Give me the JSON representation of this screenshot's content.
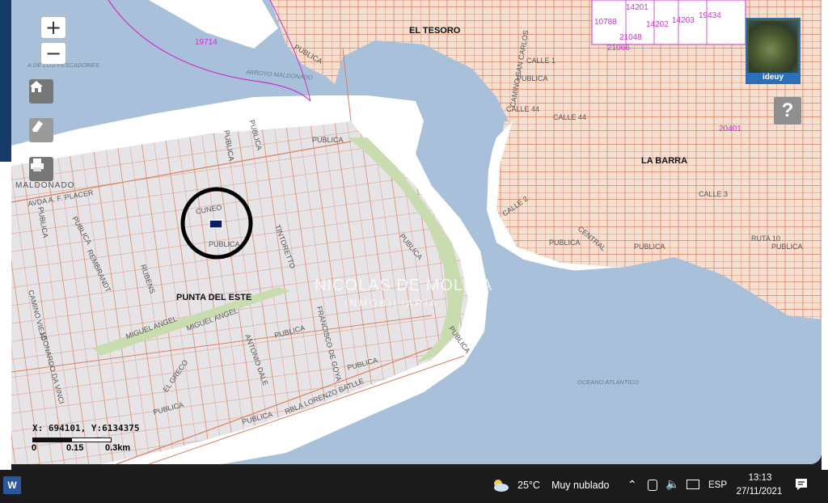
{
  "map": {
    "places": {
      "el_tesoro": "EL TESORO",
      "la_barra": "LA BARRA",
      "punta_del_este": "PUNTA DEL ESTE",
      "maldonado": "MALDONADO"
    },
    "water_labels": {
      "arroyo": "ARROYO MALDONADO",
      "oceano": "OCEANO ATLANTICO",
      "pescadores": "A DE LOS PESCADORES"
    },
    "parcels": [
      "19714",
      "14201",
      "10788",
      "14202",
      "14203",
      "19434",
      "21048",
      "21066",
      "20401"
    ],
    "streets": {
      "publica": "PUBLICA",
      "calle1": "CALLE 1",
      "calle44": "CALLE 44",
      "calle44b": "CALLE 44",
      "calle2": "CALLE 2",
      "calle3": "CALLE 3",
      "cuneo": "CUNEO",
      "avpaz": "AVDA A. F. PLACER",
      "rubens": "RUBENS",
      "miguel1": "MIGUEL ANGEL",
      "miguel2": "MIGUEL ANGEL",
      "antonio": "ANTONIO DALE",
      "francisco": "FRANCISCO DE GOYA",
      "rambla": "RBLA LORENZO BATLLE",
      "tintoretto": "TINTORETTO",
      "elgreco": "EL GRECO",
      "leonardo": "LEONARDO DA VINCI",
      "carlos": "CAMINO SAN CARLOS",
      "rembrandt": "REMBRANDT",
      "caminoviejo": "CAMINO VIEJO",
      "ruta10": "RUTA 10",
      "central": "CENTRAL"
    },
    "coordinates": "X: 694101, Y:6134375",
    "scale_labels": [
      "0",
      "0.15",
      "0.3km"
    ],
    "ideuy_label": "ideuy",
    "help_label": "?",
    "zoom_in": "+",
    "zoom_out": "−",
    "watermark": {
      "line1": "NICOLAS DE MOLINA",
      "line2": "INMOBILIARIA"
    },
    "colors": {
      "water": "#a9c0db",
      "land": "#e6e4e6",
      "beach": "#ffffff",
      "lots": "#f4dfd0",
      "lot_lines": "#d98060",
      "green": "#c9dcb0",
      "marker": "#0c1d6e",
      "circle": "#000000"
    }
  },
  "taskbar": {
    "word_icon": "W",
    "temperature": "25°C",
    "weather": "Muy nublado",
    "language": "ESP",
    "time": "13:13",
    "date": "27/11/2021"
  }
}
